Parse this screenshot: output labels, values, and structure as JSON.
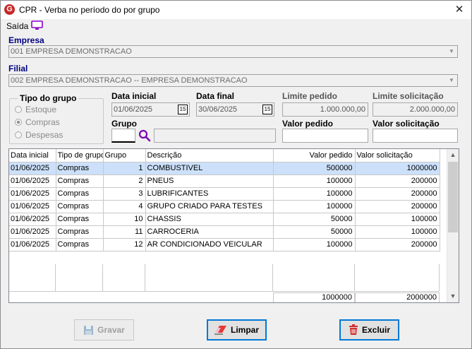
{
  "window": {
    "title": "CPR - Verba no período do por grupo",
    "close_glyph": "✕"
  },
  "menu": {
    "saida_label": "Saída",
    "saida_icon": "monitor-icon"
  },
  "empresa": {
    "label": "Empresa",
    "value": "001 EMPRESA DEMONSTRACAO"
  },
  "filial": {
    "label": "Filial",
    "value": "002 EMPRESA DEMONSTRACAO -- EMPRESA DEMONSTRACAO"
  },
  "tipo_grupo": {
    "title": "Tipo do grupo",
    "options": [
      {
        "label": "Estoque",
        "selected": false
      },
      {
        "label": "Compras",
        "selected": true
      },
      {
        "label": "Despesas",
        "selected": false
      }
    ]
  },
  "data_inicial": {
    "label": "Data inicial",
    "value": "01/06/2025",
    "cal_glyph": "15"
  },
  "data_final": {
    "label": "Data final",
    "value": "30/06/2025",
    "cal_glyph": "15"
  },
  "limite_pedido": {
    "label": "Limite pedido",
    "value": "1.000.000,00"
  },
  "limite_solicitacao": {
    "label": "Limite solicitação",
    "value": "2.000.000,00"
  },
  "grupo": {
    "label": "Grupo",
    "code": "",
    "description": ""
  },
  "valor_pedido": {
    "label": "Valor pedido",
    "value": ""
  },
  "valor_solicitacao": {
    "label": "Valor solicitação",
    "value": ""
  },
  "table": {
    "columns": [
      "Data inicial",
      "Tipo de grupo",
      "Grupo",
      "Descrição",
      "Valor pedido",
      "Valor solicitação"
    ],
    "rows": [
      [
        "01/06/2025",
        "Compras",
        "1",
        "COMBUSTIVEL",
        "500000",
        "1000000"
      ],
      [
        "01/06/2025",
        "Compras",
        "2",
        "PNEUS",
        "100000",
        "200000"
      ],
      [
        "01/06/2025",
        "Compras",
        "3",
        "LUBRIFICANTES",
        "100000",
        "200000"
      ],
      [
        "01/06/2025",
        "Compras",
        "4",
        "GRUPO CRIADO PARA TESTES",
        "100000",
        "200000"
      ],
      [
        "01/06/2025",
        "Compras",
        "10",
        "CHASSIS",
        "50000",
        "100000"
      ],
      [
        "01/06/2025",
        "Compras",
        "11",
        "CARROCERIA",
        "50000",
        "100000"
      ],
      [
        "01/06/2025",
        "Compras",
        "12",
        "AR CONDICIONADO VEICULAR",
        "100000",
        "200000"
      ]
    ],
    "selected_row": 0,
    "totals": {
      "valor_pedido": "1000000",
      "valor_solicitacao": "2000000"
    }
  },
  "buttons": {
    "gravar": {
      "label": "Gravar",
      "enabled": false
    },
    "limpar": {
      "label": "Limpar",
      "enabled": true
    },
    "excluir": {
      "label": "Excluir",
      "enabled": true
    }
  },
  "colors": {
    "selected_row": "#cce0fa",
    "label_blue": "#000080",
    "app_icon": "#c62828",
    "saida_icon": "#8b00c9"
  }
}
